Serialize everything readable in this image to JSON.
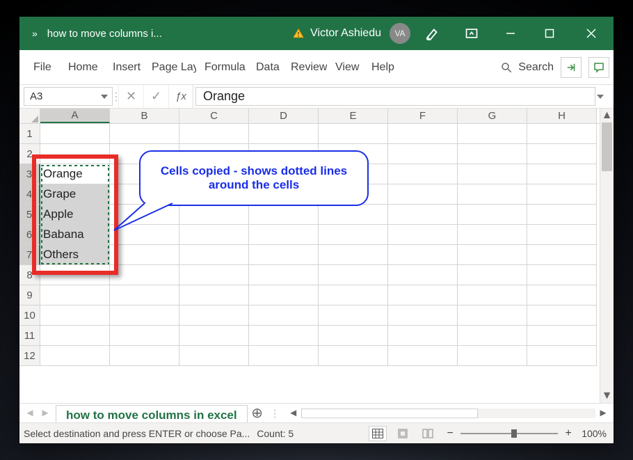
{
  "titlebar": {
    "chevron": "»",
    "doc_name": "how to move columns i...",
    "user_name": "Victor Ashiedu",
    "user_initials": "VA"
  },
  "ribbon": {
    "tabs": [
      "File",
      "Home",
      "Insert",
      "Page Lay",
      "Formula",
      "Data",
      "Review",
      "View",
      "Help"
    ],
    "search_label": "Search"
  },
  "namebox": "A3",
  "formula_value": "Orange",
  "columns": [
    "A",
    "B",
    "C",
    "D",
    "E",
    "F",
    "G",
    "H"
  ],
  "rows": [
    "1",
    "2",
    "3",
    "4",
    "5",
    "6",
    "7",
    "8",
    "9",
    "10",
    "11",
    "12"
  ],
  "cells": {
    "A3": "Orange",
    "A4": "Grape",
    "A5": "Apple",
    "A6": "Babana",
    "A7": "Others"
  },
  "callout_text": "Cells copied - shows dotted lines around the cells",
  "sheet_tab": "how to move columns in excel",
  "status": {
    "message": "Select destination and press ENTER or choose Pa...",
    "count_label": "Count: 5",
    "zoom_label": "100%"
  }
}
